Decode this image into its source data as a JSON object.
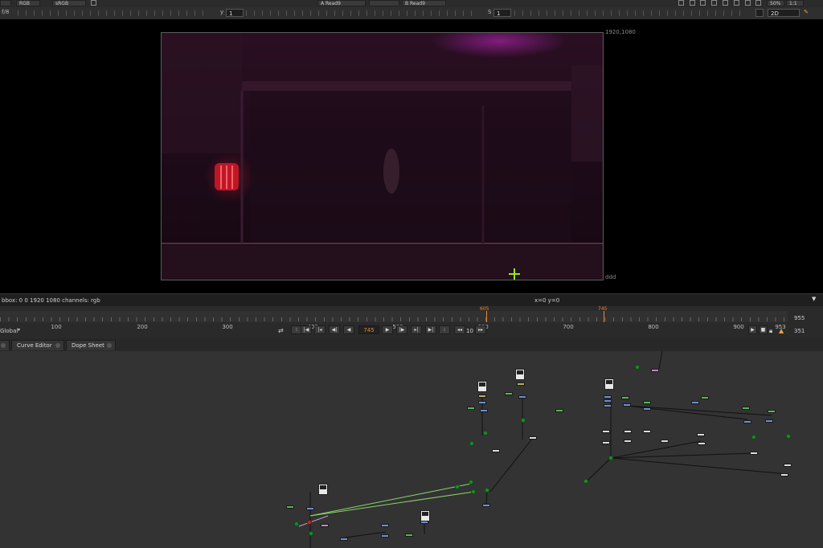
{
  "top_bar": {
    "channels": "RGB",
    "colorspace": "sRGB",
    "input_a": "A  Read9",
    "input_b": "B  Read9",
    "zoom": "50%",
    "proxy": "1:1"
  },
  "toolbar": {
    "gain_label": "f/8",
    "gain_value": "1",
    "gamma_label": "y",
    "gamma_value": "1",
    "saturation_label": "S",
    "saturation_value": "1",
    "view_mode": "2D"
  },
  "viewer": {
    "format_label": "1920,1080",
    "format_name": "ddd"
  },
  "status": {
    "info": "bbox: 0 0 1920 1080 channels: rgb",
    "coords": "x=0 y=0"
  },
  "timeline": {
    "ticks": [
      "100",
      "200",
      "300",
      "400",
      "500",
      "600",
      "700",
      "800",
      "900",
      "953"
    ],
    "in_marker": "605",
    "playhead": "745",
    "end_frame": "955",
    "current_frame": "745",
    "step": "10",
    "scope": "Global",
    "frame_count": "351"
  },
  "tabs": [
    {
      "label": "Curve Editor"
    },
    {
      "label": "Dope Sheet"
    }
  ],
  "colors": {
    "viewer_bg": "#000000",
    "graph_bg": "#333333",
    "playhead": "#e8892a",
    "node_green": "#55b855",
    "node_blue": "#6f8fd4"
  }
}
